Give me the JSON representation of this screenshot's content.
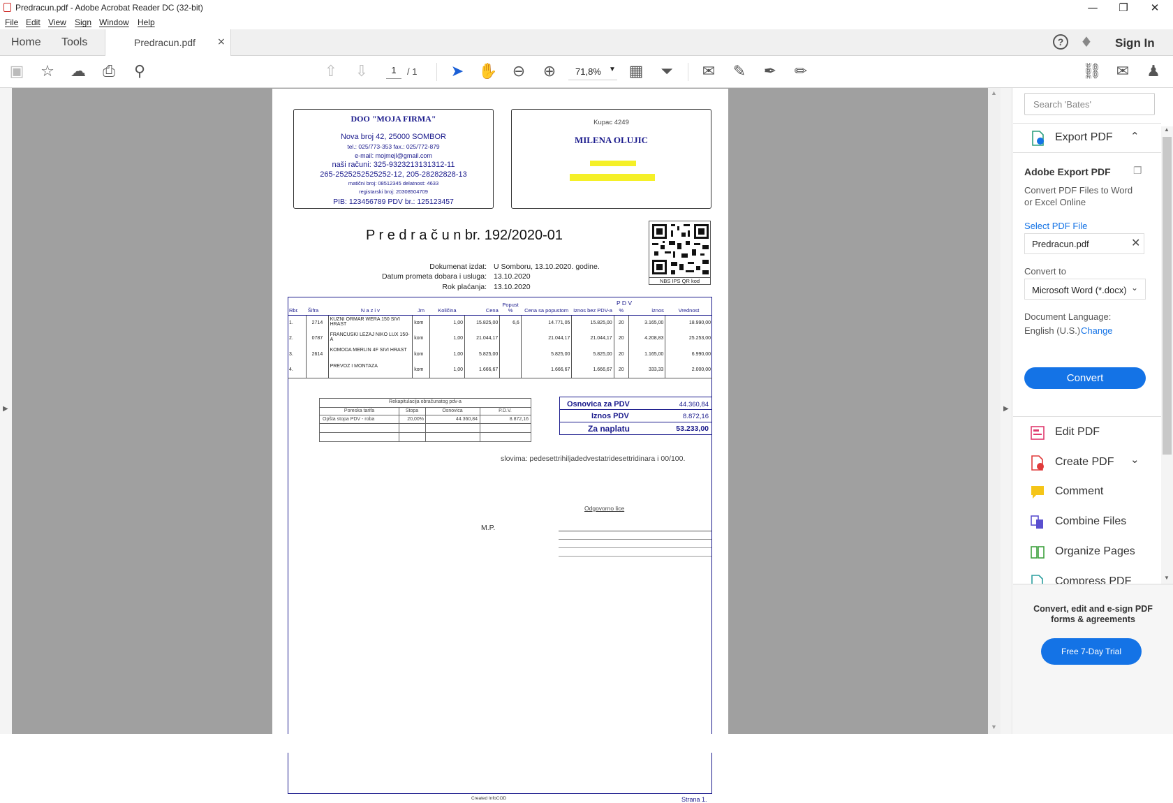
{
  "window": {
    "title": "Predracun.pdf - Adobe Acrobat Reader DC (32-bit)"
  },
  "menu": [
    "File",
    "Edit",
    "View",
    "Sign",
    "Window",
    "Help"
  ],
  "tabs": {
    "home": "Home",
    "tools": "Tools",
    "document": "Predracun.pdf",
    "sign_in": "Sign In"
  },
  "toolbar": {
    "page_current": "1",
    "page_total": "/  1",
    "zoom": "71,8%"
  },
  "document": {
    "seller": {
      "name": "DOO  \"MOJA FIRMA\"",
      "address": "Nova broj 42, 25000 SOMBOR",
      "phone": "tel.: 025/773-353  fax.: 025/772-879",
      "email": "e-mail: mojmejl@gmail.com",
      "accounts1": "naši računi:  325-9323213131312-11",
      "accounts2": "265-2525252525252-12, 205-28282828-13",
      "ids": "matični broj: 08512345  delatnost: 4633",
      "reg": "registarski broj: 20308504709",
      "pib": "PIB: 123456789  PDV br.: 125123457"
    },
    "buyer": {
      "label": "Kupac  4249",
      "name": "MILENA OLUJIC"
    },
    "title": "P r e d r a č u n   br.  192/2020-01",
    "meta": {
      "issued_label": "Dokumenat izdat:",
      "issued_value": "U Somboru, 13.10.2020. godine.",
      "traffic_label": "Datum prometa dobara i usluga:",
      "traffic_value": "13.10.2020",
      "due_label": "Rok plaćanja:",
      "due_value": "13.10.2020"
    },
    "qr_caption": "NBS  IPS QR kod",
    "table": {
      "headers": [
        "Rbr.",
        "Šifra",
        "N a z i v",
        "Jm",
        "Količina",
        "Cena",
        "Popust %",
        "Cena sa popustom",
        "Iznos bez PDV-a",
        "%",
        "iznos",
        "Vrednost"
      ],
      "pdv_group": "P D V",
      "rows": [
        [
          "1.",
          "2714",
          "KUZNI ORMAR WERA 150 SIVI HRAST",
          "kom",
          "1,00",
          "15.825,00",
          "6,6",
          "14.771,05",
          "15.825,00",
          "20",
          "3.165,00",
          "18.990,00"
        ],
        [
          "2.",
          "0787",
          "FRANCUSKI LEZAJ NIKO LUX 150-A",
          "kom",
          "1,00",
          "21.044,17",
          "",
          "21.044,17",
          "21.044,17",
          "20",
          "4.208,83",
          "25.253,00"
        ],
        [
          "3.",
          "2614",
          "KOMODA MERLIN 4F SIVI HRAST",
          "kom",
          "1,00",
          "5.825,00",
          "",
          "5.825,00",
          "5.825,00",
          "20",
          "1.165,00",
          "6.990,00"
        ],
        [
          "4.",
          "",
          "PREVOZ I MONTAZA",
          "kom",
          "1,00",
          "1.666,67",
          "",
          "1.666,67",
          "1.666,67",
          "20",
          "333,33",
          "2.000,00"
        ]
      ]
    },
    "recap": {
      "title": "Rekapitulacija obračunatog pdv-a",
      "headers": [
        "Poreska tarifa",
        "Stopa",
        "Osnovica",
        "P.D.V."
      ],
      "row": [
        "Opšta stopa PDV - roba",
        "20,00%",
        "44.360,84",
        "8.872,16"
      ]
    },
    "totals": {
      "base_label": "Osnovica za PDV",
      "base_value": "44.360,84",
      "vat_label": "Iznos PDV",
      "vat_value": "8.872,16",
      "pay_label": "Za naplatu",
      "pay_value": "53.233,00"
    },
    "words": "slovima:   pedesettrihiljadedvestatridesettridinara i  00/100.",
    "responsible": "Odgovorno lice",
    "mp": "M.P.",
    "footer_created": "Created  InfoCOD",
    "footer_page": "Strana  1."
  },
  "panel": {
    "search_placeholder": "Search 'Bates'",
    "export_title": "Export PDF",
    "adobe_export": "Adobe Export PDF",
    "desc1": "Convert PDF Files to Word",
    "desc2": "or Excel Online",
    "select_file": "Select PDF File",
    "file_name": "Predracun.pdf",
    "convert_to": "Convert to",
    "format": "Microsoft Word (*.docx)",
    "doc_lang": "Document Language:",
    "lang": "English (U.S.)",
    "change": "Change",
    "convert": "Convert",
    "tools": [
      "Edit PDF",
      "Create PDF",
      "Comment",
      "Combine Files",
      "Organize Pages",
      "Compress PDF"
    ],
    "promo1": "Convert, edit and e-sign PDF",
    "promo2": "forms & agreements",
    "trial": "Free 7-Day Trial"
  },
  "colors": {
    "accent": "#1473e6",
    "navy": "#1a1a8c",
    "highlight": "#f5f028"
  }
}
